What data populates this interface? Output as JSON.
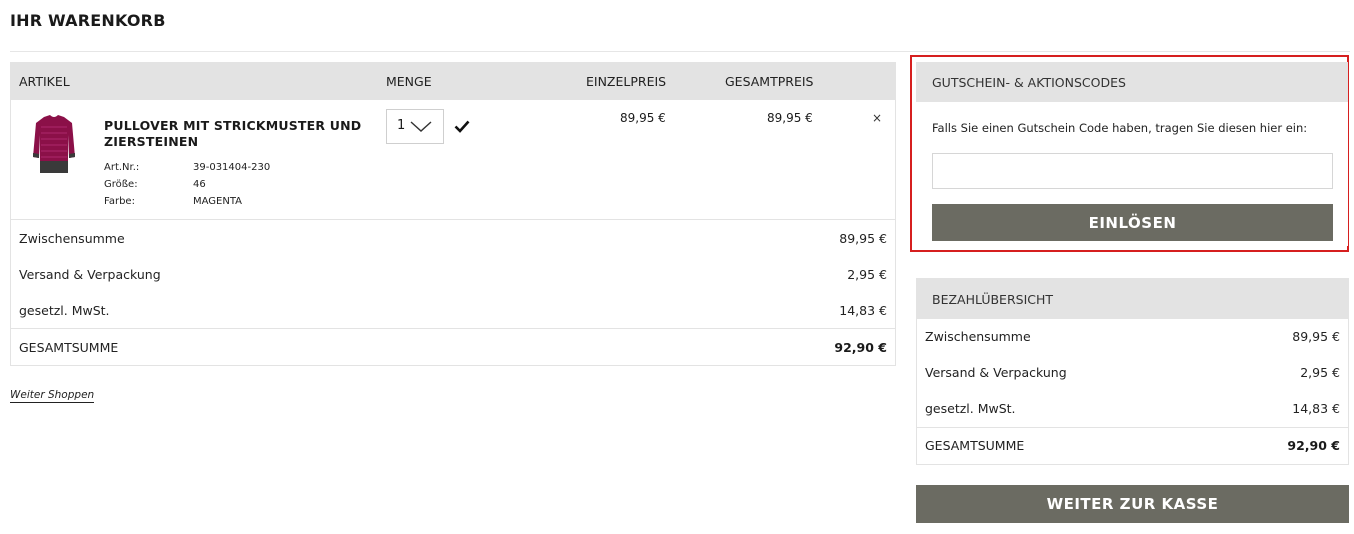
{
  "page": {
    "title": "IHR WARENKORB"
  },
  "cart": {
    "headers": {
      "artikel": "ARTIKEL",
      "menge": "MENGE",
      "einzelpreis": "EINZELPREIS",
      "gesamtpreis": "GESAMTPREIS"
    },
    "item": {
      "name": "PULLOVER MIT STRICKMUSTER UND ZIERSTEINEN",
      "meta": [
        {
          "label": "Art.Nr.:",
          "value": "39-031404-230"
        },
        {
          "label": "Größe:",
          "value": "46"
        },
        {
          "label": "Farbe:",
          "value": "MAGENTA"
        }
      ],
      "quantity": "1",
      "einzelpreis": "89,95 €",
      "gesamtpreis": "89,95 €",
      "remove": "×"
    },
    "summary": [
      {
        "label": "Zwischensumme",
        "value": "89,95 €"
      },
      {
        "label": "Versand & Verpackung",
        "value": "2,95 €"
      },
      {
        "label": "gesetzl. MwSt.",
        "value": "14,83 €"
      }
    ],
    "total": {
      "label": "GESAMTSUMME",
      "value": "92,90 €"
    },
    "continue_link": "Weiter Shoppen"
  },
  "coupon": {
    "title": "GUTSCHEIN- & AKTIONSCODES",
    "hint": "Falls Sie einen Gutschein Code haben, tragen Sie diesen hier ein:",
    "input_value": "",
    "button": "EINLÖSEN"
  },
  "payment": {
    "title": "BEZAHLÜBERSICHT",
    "summary": [
      {
        "label": "Zwischensumme",
        "value": "89,95 €"
      },
      {
        "label": "Versand & Verpackung",
        "value": "2,95 €"
      },
      {
        "label": "gesetzl. MwSt.",
        "value": "14,83 €"
      }
    ],
    "total": {
      "label": "GESAMTSUMME",
      "value": "92,90 €"
    }
  },
  "checkout": {
    "button": "WEITER ZUR KASSE"
  },
  "colors": {
    "highlight": "#d61f1f",
    "button": "#6b6b62",
    "header_bg": "#e3e3e3",
    "product": "#8b1048"
  },
  "icons": {
    "quantity_dropdown": "chevron-down-icon",
    "confirm": "checkmark-icon",
    "remove": "close-icon",
    "product": "pullover-image"
  }
}
